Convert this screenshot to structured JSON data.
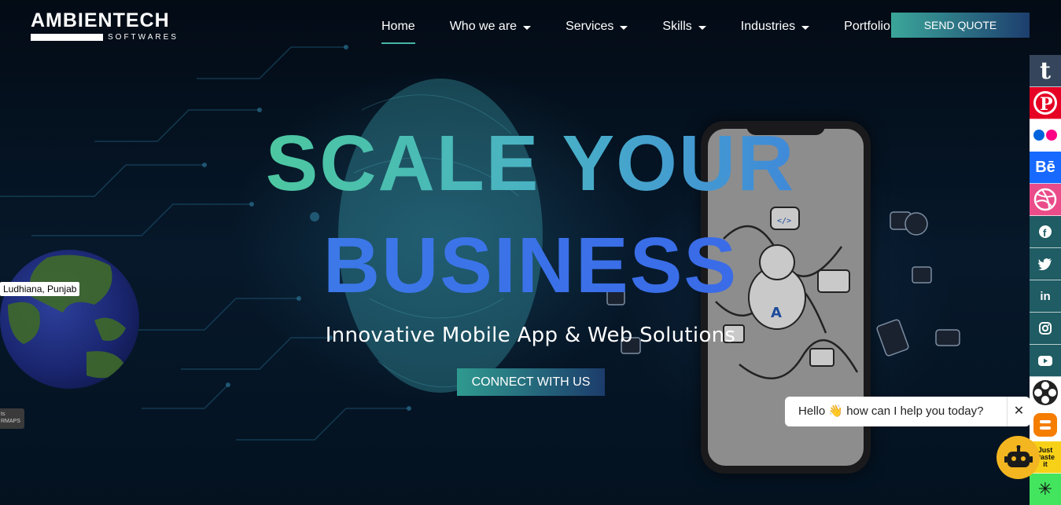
{
  "brand": {
    "name": "AMBIENTECH",
    "sub": "SOFTWARES"
  },
  "nav": {
    "items": [
      {
        "label": "Home",
        "active": true,
        "dropdown": false
      },
      {
        "label": "Who we are",
        "active": false,
        "dropdown": true
      },
      {
        "label": "Services",
        "active": false,
        "dropdown": true
      },
      {
        "label": "Skills",
        "active": false,
        "dropdown": true
      },
      {
        "label": "Industries",
        "active": false,
        "dropdown": true
      },
      {
        "label": "Portfolio",
        "active": false,
        "dropdown": false
      }
    ],
    "quote_label": "SEND QUOTE"
  },
  "hero": {
    "line1": "SCALE YOUR",
    "line2": "BUSINESS",
    "subtitle": "Innovative Mobile App & Web Solutions",
    "cta_label": "CONNECT WITH US"
  },
  "globe": {
    "location_label": "Ludhiana, Punjab",
    "credit_line1": "ts",
    "credit_line2": "RMAPS"
  },
  "social": [
    {
      "icon": "tumblr-icon",
      "glyph": "t",
      "color": "#35465c"
    },
    {
      "icon": "pinterest-icon",
      "glyph": "P",
      "color": "#e60023"
    },
    {
      "icon": "flickr-icon",
      "glyph": "",
      "color": "#ffffff"
    },
    {
      "icon": "behance-icon",
      "glyph": "Bē",
      "color": "#1769ff"
    },
    {
      "icon": "dribbble-icon",
      "glyph": "",
      "color": "#ea4c89"
    },
    {
      "icon": "facebook-icon",
      "glyph": "f",
      "color": "#1f5c63"
    },
    {
      "icon": "twitter-icon",
      "glyph": "",
      "color": "#1f5c63"
    },
    {
      "icon": "linkedin-icon",
      "glyph": "in",
      "color": "#1f5c63"
    },
    {
      "icon": "instagram-icon",
      "glyph": "",
      "color": "#1f5c63"
    },
    {
      "icon": "youtube-icon",
      "glyph": "",
      "color": "#1f5c63"
    },
    {
      "icon": "reel-icon",
      "glyph": "",
      "color": "#ffffff"
    },
    {
      "icon": "blogger-icon",
      "glyph": "",
      "color": "#f57d00"
    },
    {
      "icon": "justpaste-icon",
      "glyph": "Just Paste it",
      "color": "#f7d117"
    },
    {
      "icon": "linktree-icon",
      "glyph": "✳",
      "color": "#43e55e"
    }
  ],
  "chat": {
    "greeting": "Hello 👋 how can I help you today?",
    "close": "✕"
  }
}
